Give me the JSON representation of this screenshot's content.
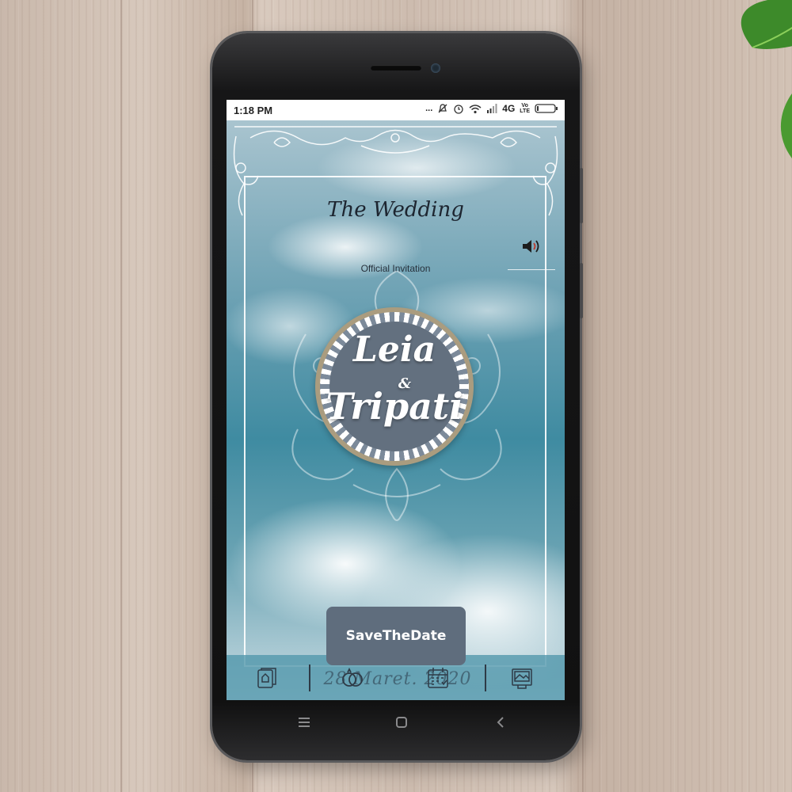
{
  "status_bar": {
    "time": "1:18 PM",
    "indicators": [
      "...",
      "mute-icon",
      "alarm-icon",
      "wifi-icon",
      "signal-icon",
      "4G",
      "VoLTE",
      "battery-icon"
    ],
    "network": "4G",
    "volte_line1": "Vo",
    "volte_line2": "LTE"
  },
  "invitation": {
    "heading": "The Wedding",
    "subheading": "Official Invitation",
    "bride": "Leia",
    "ampersand": "&",
    "groom": "Tripati",
    "cta_label": "SaveTheDate",
    "date_text": "28 Maret. 2020"
  },
  "bottom_nav": {
    "icons": [
      "home-card-icon",
      "rings-icon",
      "calendar-icon",
      "gallery-icon"
    ]
  },
  "softkeys": [
    "menu-icon",
    "home-icon",
    "back-icon"
  ],
  "colors": {
    "button": "#5f6d7d",
    "medallion": "#63707f",
    "sky": "#3f8ba1"
  }
}
